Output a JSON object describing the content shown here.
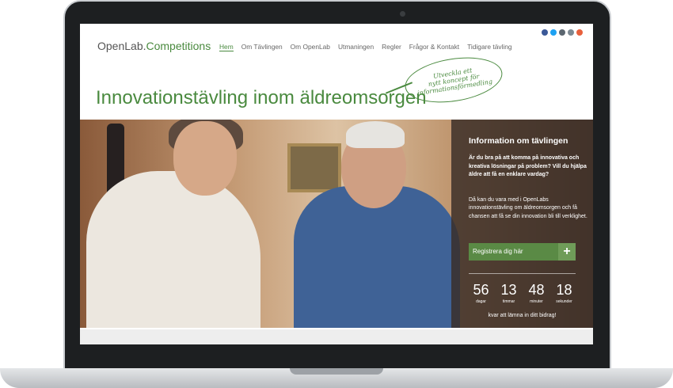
{
  "site": {
    "logo_main": "OpenLab.",
    "logo_accent": "Competitions"
  },
  "nav": {
    "items": [
      {
        "label": "Hem",
        "active": true
      },
      {
        "label": "Om Tävlingen"
      },
      {
        "label": "Om OpenLab"
      },
      {
        "label": "Utmaningen"
      },
      {
        "label": "Regler"
      },
      {
        "label": "Frågor & Kontakt"
      },
      {
        "label": "Tidigare tävling"
      }
    ]
  },
  "social_icons": [
    {
      "name": "facebook-icon",
      "color": "#3b5998"
    },
    {
      "name": "twitter-icon",
      "color": "#1da1f2"
    },
    {
      "name": "email-icon",
      "color": "#5b6670"
    },
    {
      "name": "rss-icon",
      "color": "#7d8a93"
    },
    {
      "name": "plus-icon",
      "color": "#e8603c"
    }
  ],
  "hero": {
    "title": "Innovationstävling inom äldreomsorgen",
    "callout_lines": [
      "Utveckla ett",
      "nytt koncept för",
      "informationsförmedling"
    ]
  },
  "info": {
    "title": "Information om tävlingen",
    "bold_text": "Är du bra på att komma på innovativa och kreativa lösningar på problem? Vill du hjälpa äldre att få en enklare vardag?",
    "text": "Då kan du vara med i OpenLabs innovationstävling om äldreomsorgen och få chansen att få se din innovation bli till verklighet.",
    "register_label": "Registrera dig här",
    "register_icon": "+",
    "countdown": [
      {
        "value": "56",
        "label": "dagar"
      },
      {
        "value": "13",
        "label": "timmar"
      },
      {
        "value": "48",
        "label": "minuter"
      },
      {
        "value": "18",
        "label": "sekunder"
      }
    ],
    "countdown_footer": "kvar att lämna in ditt bidrag!"
  },
  "colors": {
    "brand_green": "#4a8a3f",
    "panel_bg": "#3a2e28",
    "button_green": "#5a8a45"
  }
}
